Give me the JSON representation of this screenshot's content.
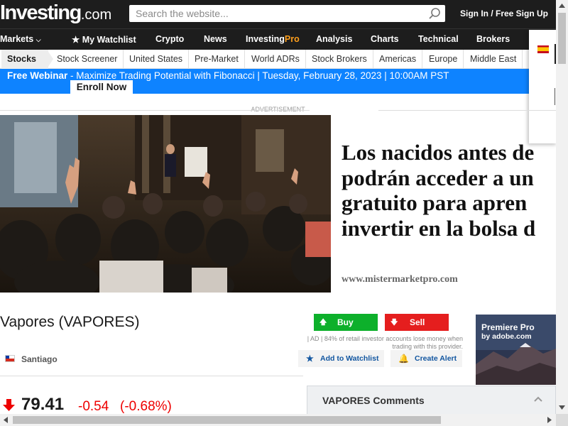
{
  "header": {
    "logo_main": "Investing",
    "logo_suffix": ".com",
    "search_placeholder": "Search the website...",
    "signin": "Sign In / Free Sign Up"
  },
  "nav": {
    "markets": "Markets",
    "watchlist": "My Watchlist",
    "crypto": "Crypto",
    "news": "News",
    "investing_pro_a": "Investing",
    "investing_pro_b": "Pro",
    "analysis": "Analysis",
    "charts": "Charts",
    "technical": "Technical",
    "brokers": "Brokers"
  },
  "subnav": {
    "items": [
      "Stocks",
      "Stock Screener",
      "United States",
      "Pre-Market",
      "World ADRs",
      "Stock Brokers",
      "Americas",
      "Europe",
      "Middle East"
    ]
  },
  "banner": {
    "strong": "Free Webinar",
    "text": " - Maximize Trading Potential with Fibonacci | Tuesday, February 28, 2023 | 10:00AM PST",
    "cta": "Enroll Now"
  },
  "ad": {
    "label": "ADVERTISEMENT",
    "headline": "Los nacidos antes de\npodrán acceder a un\ngratuito para apren\ninvertir en la bolsa d",
    "url": "www.mistermarketpro.com"
  },
  "instrument": {
    "title": "Vapores (VAPORES)",
    "exchange": "Santiago",
    "price": "79.41",
    "change": "-0.54",
    "change_pct": "(-0.68%)",
    "buy_label": "Buy",
    "sell_label": "Sell",
    "disclaimer": "| AD | 84% of retail investor accounts lose money when trading with this provider.",
    "watchlist_label": "Add to Watchlist",
    "alert_label": "Create Alert"
  },
  "side_ad": {
    "line1": "Premiere Pro",
    "line2": "by adobe.com"
  },
  "comments": {
    "label": "VAPORES Comments"
  },
  "colors": {
    "header_bg": "#1d1d1d",
    "banner_bg": "#0e83ff",
    "buy": "#0db02b",
    "sell": "#e51e1e",
    "negative": "#ee0000",
    "link": "#1256a0",
    "pro_accent": "#ff9f1c"
  }
}
